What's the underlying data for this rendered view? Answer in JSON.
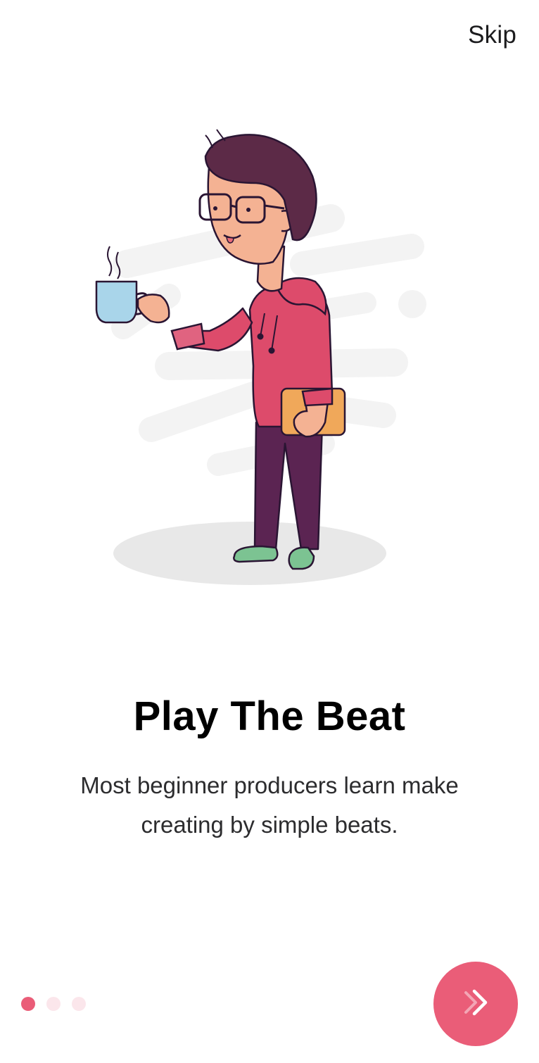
{
  "header": {
    "skip_label": "Skip"
  },
  "onboarding": {
    "title": "Play The Beat",
    "subtitle": "Most beginner producers learn make creating by simple beats."
  },
  "pager": {
    "total_pages": 3,
    "current_page": 1
  },
  "next_button": {
    "icon": "double-chevron-right-icon"
  },
  "colors": {
    "accent": "#ea5d78",
    "dot_inactive": "#fbe6eb",
    "text_primary": "#000000",
    "text_secondary": "#2c2c2e"
  }
}
